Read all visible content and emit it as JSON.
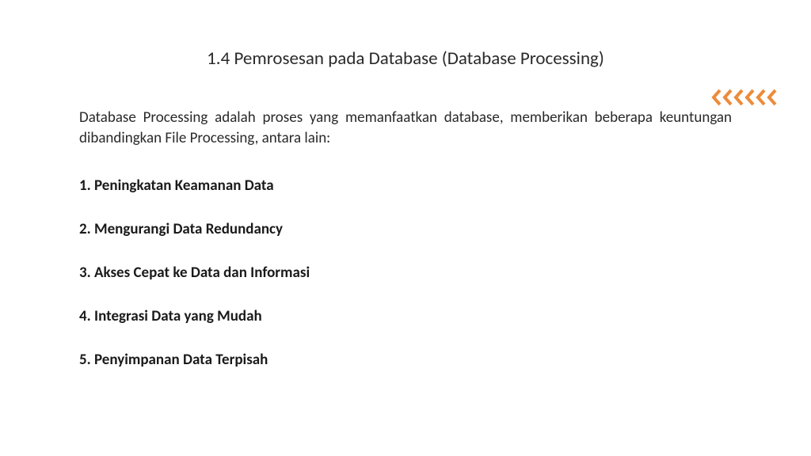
{
  "title": "1.4 Pemrosesan pada Database (Database Processing)",
  "intro": "Database Processing adalah proses yang memanfaatkan database, memberikan beberapa keuntungan dibandingkan File Processing, antara lain:",
  "items": [
    "1. Peningkatan Keamanan Data",
    "2. Mengurangi Data Redundancy",
    "3. Akses Cepat ke Data dan Informasi",
    "4. Integrasi Data yang Mudah",
    "5. Penyimpanan Data Terpisah"
  ],
  "accentColor": "#ec8b3a",
  "chevronCount": 6
}
